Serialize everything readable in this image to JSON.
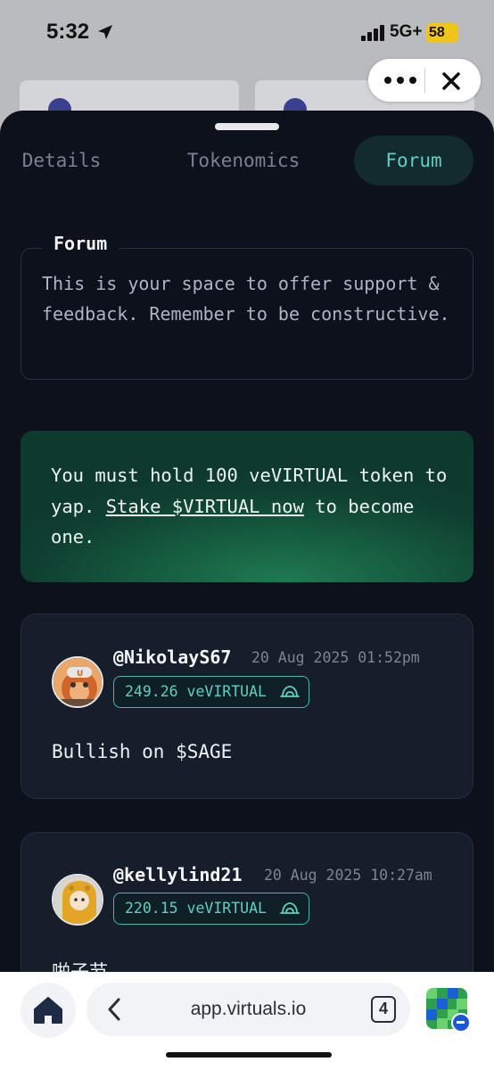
{
  "status_bar": {
    "time": "5:32",
    "network": "5G+",
    "battery": "58"
  },
  "tabs": [
    {
      "label": "Details",
      "active": false
    },
    {
      "label": "Tokenomics",
      "active": false
    },
    {
      "label": "Forum",
      "active": true
    }
  ],
  "forum": {
    "legend": "Forum",
    "description": "This is your space to offer support & feedback. Remember to be constructive."
  },
  "banner": {
    "text_before": "You must hold 100 veVIRTUAL token to yap. ",
    "link_text": "Stake $VIRTUAL now",
    "text_after": " to become one."
  },
  "posts": [
    {
      "handle": "@NikolayS67",
      "date": "20 Aug 2025 01:52pm",
      "balance": "249.26 veVIRTUAL",
      "body": "Bullish on $SAGE",
      "avatar_icon": "orange-monkey-avatar-icon"
    },
    {
      "handle": "@kellylind21",
      "date": "20 Aug 2025 10:27am",
      "balance": "220.15 veVIRTUAL",
      "body": "啪子节",
      "avatar_icon": "yellow-hoodie-avatar-icon"
    }
  ],
  "browser": {
    "url": "app.virtuals.io",
    "tab_count": "4"
  },
  "colors": {
    "sheet_bg": "#0c111c",
    "accent_teal": "#5fd0c0",
    "card_bg": "#161d2b",
    "banner_green": "#1f7a50"
  }
}
